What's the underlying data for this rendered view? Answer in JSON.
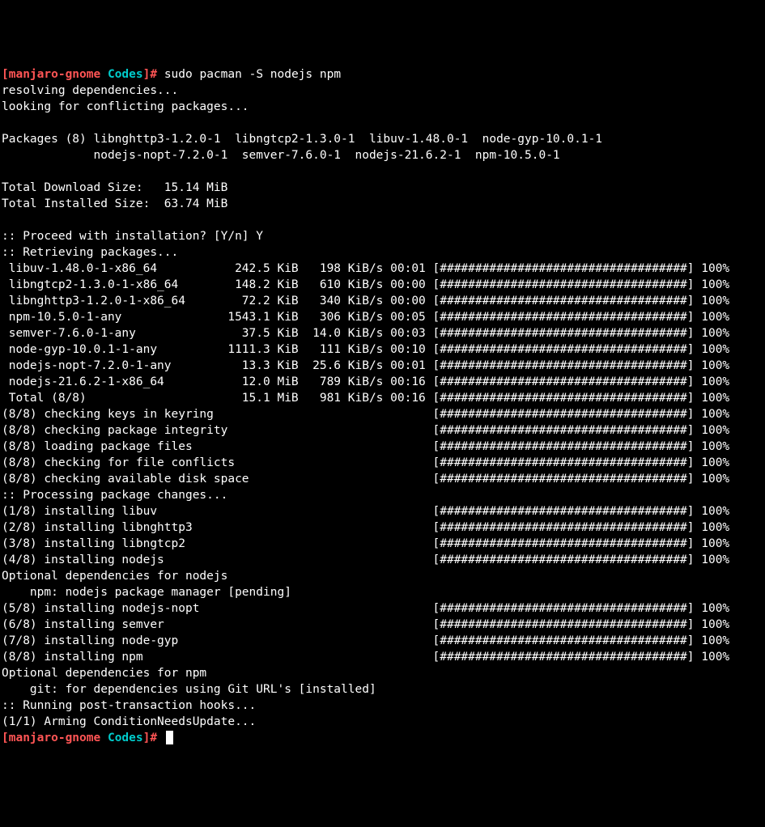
{
  "prompt": {
    "bracket_open": "[",
    "host": "manjaro-gnome",
    "dir": "Codes",
    "bracket_close": "]#",
    "space": " "
  },
  "command": "sudo pacman -S nodejs npm",
  "l1": "resolving dependencies...",
  "l2": "looking for conflicting packages...",
  "l3": "",
  "l4": "Packages (8) libnghttp3-1.2.0-1  libngtcp2-1.3.0-1  libuv-1.48.0-1  node-gyp-10.0.1-1",
  "l5": "             nodejs-nopt-7.2.0-1  semver-7.6.0-1  nodejs-21.6.2-1  npm-10.5.0-1",
  "l6": "",
  "l7": "Total Download Size:   15.14 MiB",
  "l8": "Total Installed Size:  63.74 MiB",
  "l9": "",
  "l10": ":: Proceed with installation? [Y/n] Y",
  "l11": ":: Retrieving packages...",
  "l12": " libuv-1.48.0-1-x86_64           242.5 KiB   198 KiB/s 00:01 [###################################] 100%",
  "l13": " libngtcp2-1.3.0-1-x86_64        148.2 KiB   610 KiB/s 00:00 [###################################] 100%",
  "l14": " libnghttp3-1.2.0-1-x86_64        72.2 KiB   340 KiB/s 00:00 [###################################] 100%",
  "l15": " npm-10.5.0-1-any               1543.1 KiB   306 KiB/s 00:05 [###################################] 100%",
  "l16": " semver-7.6.0-1-any               37.5 KiB  14.0 KiB/s 00:03 [###################################] 100%",
  "l17": " node-gyp-10.0.1-1-any          1111.3 KiB   111 KiB/s 00:10 [###################################] 100%",
  "l18": " nodejs-nopt-7.2.0-1-any          13.3 KiB  25.6 KiB/s 00:01 [###################################] 100%",
  "l19": " nodejs-21.6.2-1-x86_64           12.0 MiB   789 KiB/s 00:16 [###################################] 100%",
  "l20": " Total (8/8)                      15.1 MiB   981 KiB/s 00:16 [###################################] 100%",
  "l21": "(8/8) checking keys in keyring                               [###################################] 100%",
  "l22": "(8/8) checking package integrity                             [###################################] 100%",
  "l23": "(8/8) loading package files                                  [###################################] 100%",
  "l24": "(8/8) checking for file conflicts                            [###################################] 100%",
  "l25": "(8/8) checking available disk space                          [###################################] 100%",
  "l26": ":: Processing package changes...",
  "l27": "(1/8) installing libuv                                       [###################################] 100%",
  "l28": "(2/8) installing libnghttp3                                  [###################################] 100%",
  "l29": "(3/8) installing libngtcp2                                   [###################################] 100%",
  "l30": "(4/8) installing nodejs                                      [###################################] 100%",
  "l31": "Optional dependencies for nodejs",
  "l32": "    npm: nodejs package manager [pending]",
  "l33": "(5/8) installing nodejs-nopt                                 [###################################] 100%",
  "l34": "(6/8) installing semver                                      [###################################] 100%",
  "l35": "(7/8) installing node-gyp                                    [###################################] 100%",
  "l36": "(8/8) installing npm                                         [###################################] 100%",
  "l37": "Optional dependencies for npm",
  "l38": "    git: for dependencies using Git URL's [installed]",
  "l39": ":: Running post-transaction hooks...",
  "l40": "(1/1) Arming ConditionNeedsUpdate..."
}
